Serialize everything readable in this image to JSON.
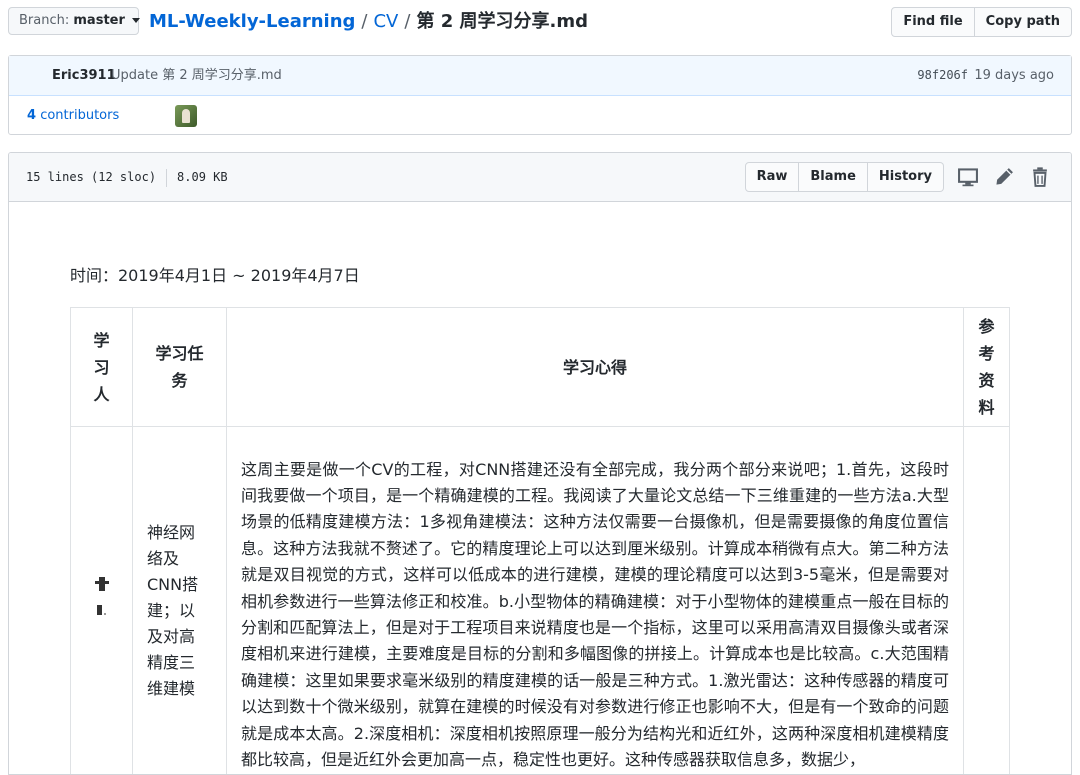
{
  "branch": {
    "label": "Branch:",
    "value": "master"
  },
  "breadcrumb": {
    "repo": "ML-Weekly-Learning",
    "folder": "CV",
    "file": "第 2 周学习分享.md",
    "separator": "/"
  },
  "top_buttons": {
    "find_file": "Find file",
    "copy_path": "Copy path"
  },
  "commit": {
    "author": "Eric3911",
    "message": "Update 第 2 周学习分享.md",
    "sha": "98f206f",
    "time": "19 days ago"
  },
  "contributors": {
    "count": "4",
    "label": "contributors"
  },
  "file": {
    "lines": "15 lines (12 sloc)",
    "size": "8.09 KB",
    "actions": {
      "raw": "Raw",
      "blame": "Blame",
      "history": "History"
    },
    "icons": [
      "desktop-icon",
      "pencil-icon",
      "trash-icon"
    ]
  },
  "doc": {
    "time": "时间：2019年4月1日 ~ 2019年4月7日",
    "headers": {
      "person": "学习人",
      "task": "学习任务",
      "notes": "学习心得",
      "ref": "参考资料"
    },
    "row": {
      "task": "神经网络及CNN搭建；以及对高精度三维建模",
      "notes": "这周主要是做一个CV的工程，对CNN搭建还没有全部完成，我分两个部分来说吧；1.首先，这段时间我要做一个项目，是一个精确建模的工程。我阅读了大量论文总结一下三维重建的一些方法a.大型场景的低精度建模方法：1多视角建模法：这种方法仅需要一台摄像机，但是需要摄像的角度位置信息。这种方法我就不赘述了。它的精度理论上可以达到厘米级别。计算成本稍微有点大。第二种方法就是双目视觉的方式，这样可以低成本的进行建模，建模的理论精度可以达到3-5毫米，但是需要对相机参数进行一些算法修正和校准。b.小型物体的精确建模：对于小型物体的建模重点一般在目标的分割和匹配算法上，但是对于工程项目来说精度也是一个指标，这里可以采用高清双目摄像头或者深度相机来进行建模，主要难度是目标的分割和多幅图像的拼接上。计算成本也是比较高。c.大范围精确建模：这里如果要求毫米级别的精度建模的话一般是三种方式。1.激光雷达：这种传感器的精度可以达到数十个微米级别，就算在建模的时候没有对参数进行修正也影响不大，但是有一个致命的问题就是成本太高。2.深度相机：深度相机按照原理一般分为结构光和近红外，这两种深度相机建模精度都比较高，但是近红外会更加高一点，稳定性也更好。这种传感器获取信息多，数据少，"
    }
  },
  "colors": {
    "link": "#0366d6",
    "border": "#d1d5da",
    "commit_bg": "#f1f8ff",
    "header_bg": "#f6f8fa"
  }
}
